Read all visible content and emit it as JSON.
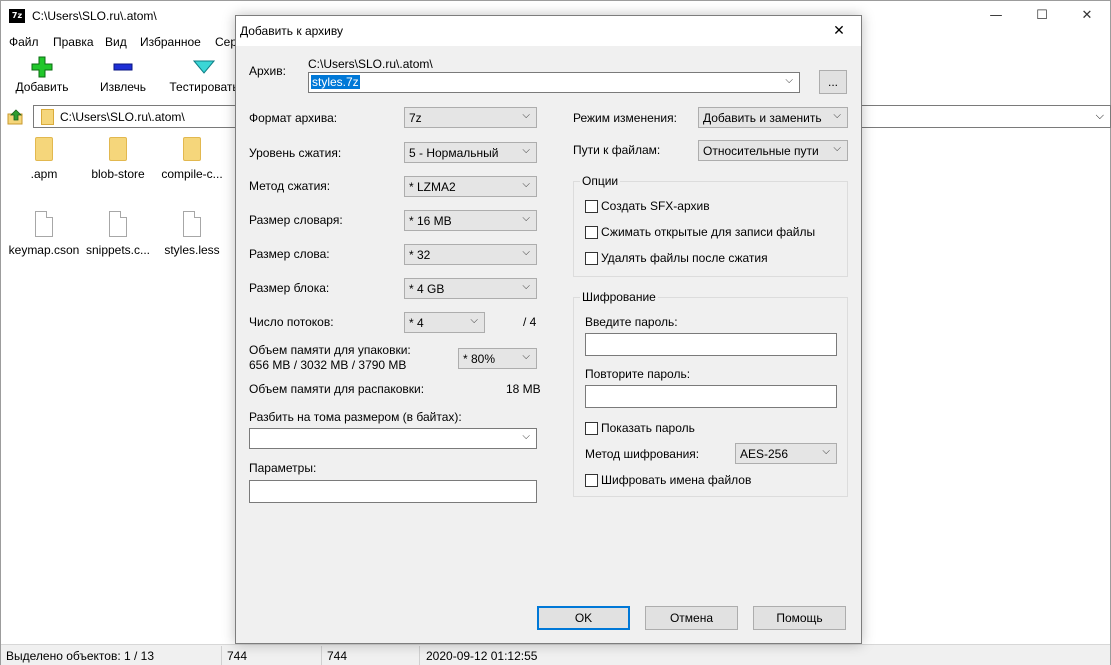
{
  "window": {
    "icon_text": "7z",
    "title": "C:\\Users\\SLO.ru\\.atom\\",
    "minimize_glyph": "—",
    "maximize_glyph": "☐",
    "close_glyph": "✕"
  },
  "menu": [
    "Файл",
    "Правка",
    "Вид",
    "Избранное",
    "Сер"
  ],
  "toolbar": {
    "add": "Добавить",
    "extract": "Извлечь",
    "test": "Тестировать"
  },
  "address": {
    "path": "C:\\Users\\SLO.ru\\.atom\\"
  },
  "files": [
    {
      "name": ".apm",
      "type": "folder"
    },
    {
      "name": "blob-store",
      "type": "folder"
    },
    {
      "name": "compile-c...",
      "type": "folder"
    },
    {
      "name": "keymap.cson",
      "type": "file"
    },
    {
      "name": "snippets.c...",
      "type": "file"
    },
    {
      "name": "styles.less",
      "type": "file"
    }
  ],
  "status": {
    "selected": "Выделено объектов: 1 / 13",
    "size": "744",
    "packed": "744",
    "modified": "2020-09-12 01:12:55"
  },
  "dialog": {
    "title": "Добавить к архиву",
    "close_glyph": "✕",
    "archive_label": "Архив:",
    "archive_dir": "C:\\Users\\SLO.ru\\.atom\\",
    "archive_name": "styles.7z",
    "browse_label": "...",
    "format_label": "Формат архива:",
    "format_value": "7z",
    "level_label": "Уровень сжатия:",
    "level_value": "5 - Нормальный",
    "method_label": "Метод сжатия:",
    "method_value": "*  LZMA2",
    "dict_label": "Размер словаря:",
    "dict_value": "*  16 MB",
    "word_label": "Размер слова:",
    "word_value": "*  32",
    "block_label": "Размер блока:",
    "block_value": "*  4 GB",
    "threads_label": "Число потоков:",
    "threads_value": "*  4",
    "threads_total": "/ 4",
    "mem_pack_label": "Объем памяти для упаковки:",
    "mem_pack_value": "656 MB / 3032 MB / 3790 MB",
    "mem_percent": "* 80%",
    "mem_unpack_label": "Объем памяти для распаковки:",
    "mem_unpack_value": "18 MB",
    "split_label": "Разбить на тома размером (в байтах):",
    "split_value": "",
    "params_label": "Параметры:",
    "params_value": "",
    "update_mode_label": "Режим изменения:",
    "update_mode_value": "Добавить и заменить",
    "paths_label": "Пути к файлам:",
    "paths_value": "Относительные пути",
    "options_group": "Опции",
    "opt_sfx": "Создать SFX-архив",
    "opt_shared": "Сжимать открытые для записи файлы",
    "opt_delete": "Удалять файлы после сжатия",
    "encryption_group": "Шифрование",
    "password_label": "Введите пароль:",
    "password_value": "",
    "repeat_label": "Повторите пароль:",
    "repeat_value": "",
    "show_password": "Показать пароль",
    "enc_method_label": "Метод шифрования:",
    "enc_method_value": "AES-256",
    "encrypt_names": "Шифровать имена файлов",
    "ok": "OK",
    "cancel": "Отмена",
    "help": "Помощь"
  },
  "colors": {
    "accent": "#0078d7",
    "selection": "#0078d7",
    "dialog_bg": "#f0f0f0"
  }
}
